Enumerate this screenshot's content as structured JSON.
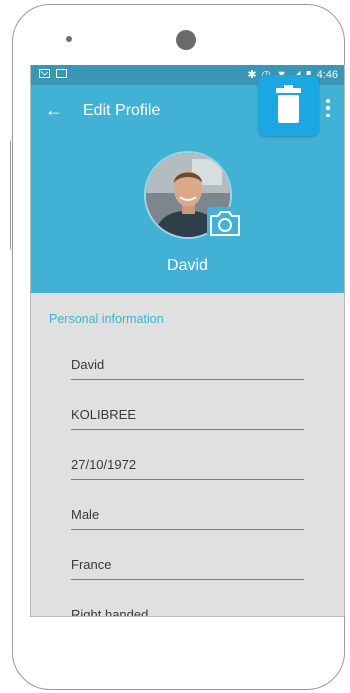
{
  "status_bar": {
    "time": "4:46"
  },
  "app_bar": {
    "title": "Edit Profile"
  },
  "profile": {
    "name": "David"
  },
  "personal_info": {
    "section_label": "Personal information",
    "fields": [
      {
        "name": "first-name",
        "value": "David"
      },
      {
        "name": "last-name",
        "value": "KOLIBREE"
      },
      {
        "name": "birth-date",
        "value": "27/10/1972"
      },
      {
        "name": "gender",
        "value": "Male"
      },
      {
        "name": "country",
        "value": "France"
      },
      {
        "name": "handedness",
        "value": "Right handed"
      }
    ]
  },
  "icons": {
    "back": "arrow-left-icon",
    "menu": "overflow-menu-icon",
    "camera": "camera-icon",
    "trash": "trash-icon"
  },
  "colors": {
    "primary": "#41b2d6",
    "status_bar": "#3b95b4",
    "trash_button": "#1aa7e2",
    "form_background": "#e0e0e0"
  }
}
